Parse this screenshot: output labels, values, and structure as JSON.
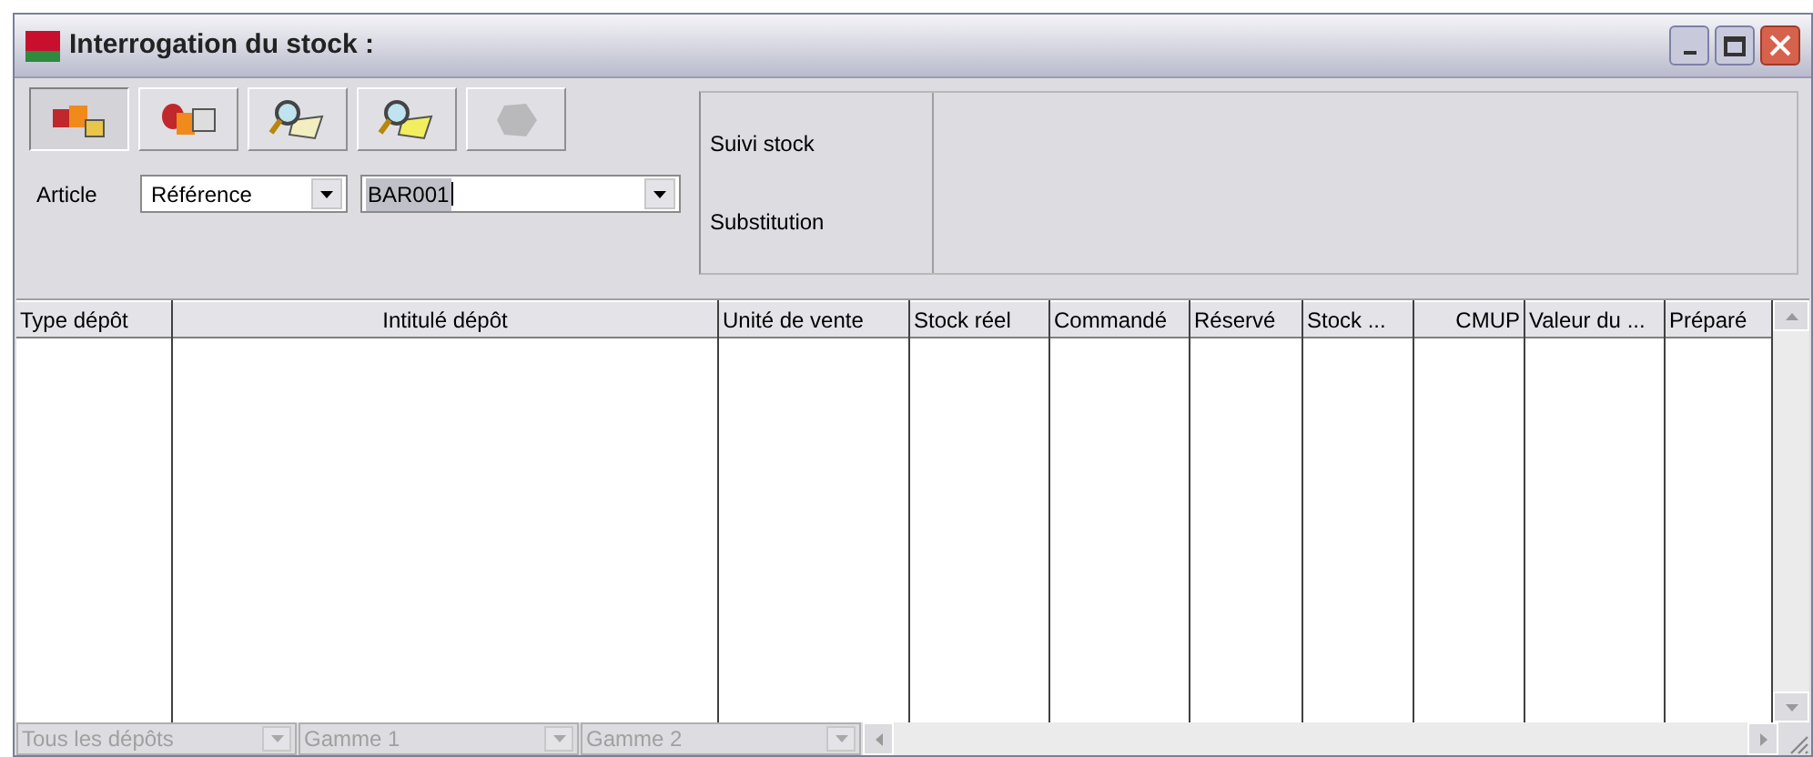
{
  "window": {
    "title": "Interrogation du stock :"
  },
  "toolbar": [
    {
      "selected": true,
      "disabled": false,
      "kind": "boxes"
    },
    {
      "selected": false,
      "disabled": false,
      "kind": "boxes2"
    },
    {
      "selected": false,
      "disabled": false,
      "kind": "search"
    },
    {
      "selected": false,
      "disabled": false,
      "kind": "search2"
    },
    {
      "selected": false,
      "disabled": true,
      "kind": "shape"
    }
  ],
  "article": {
    "label": "Article",
    "type_value": "Référence",
    "value": "BAR001"
  },
  "links": [
    "Suivi stock",
    "Substitution"
  ],
  "table": {
    "columns": [
      {
        "label": "Type dépôt"
      },
      {
        "label": "Intitulé dépôt"
      },
      {
        "label": "Unité de vente"
      },
      {
        "label": "Stock réel"
      },
      {
        "label": "Commandé"
      },
      {
        "label": "Réservé"
      },
      {
        "label": "Stock ..."
      },
      {
        "label": "CMUP"
      },
      {
        "label": "Valeur du ..."
      },
      {
        "label": "Préparé"
      }
    ]
  },
  "filters": [
    {
      "value": "Tous les dépôts",
      "disabled": true
    },
    {
      "value": "Gamme 1",
      "disabled": true
    },
    {
      "value": "Gamme 2",
      "disabled": true
    }
  ]
}
